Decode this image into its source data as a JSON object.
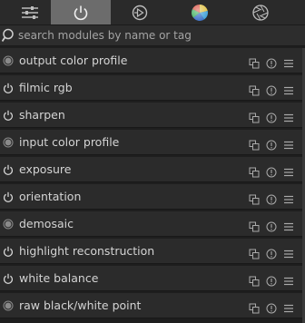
{
  "tabs": [
    {
      "icon": "sliders-icon",
      "active": false
    },
    {
      "icon": "power-icon",
      "active": true
    },
    {
      "icon": "play-circle-icon",
      "active": false
    },
    {
      "icon": "color-wheel-icon",
      "active": false
    },
    {
      "icon": "aperture-icon",
      "active": false
    }
  ],
  "search": {
    "placeholder": "search modules by name or tag",
    "value": ""
  },
  "modules": [
    {
      "label": "output color profile",
      "state": "always-on"
    },
    {
      "label": "filmic rgb",
      "state": "on"
    },
    {
      "label": "sharpen",
      "state": "on"
    },
    {
      "label": "input color profile",
      "state": "always-on"
    },
    {
      "label": "exposure",
      "state": "on"
    },
    {
      "label": "orientation",
      "state": "on"
    },
    {
      "label": "demosaic",
      "state": "always-on"
    },
    {
      "label": "highlight reconstruction",
      "state": "on"
    },
    {
      "label": "white balance",
      "state": "on"
    },
    {
      "label": "raw black/white point",
      "state": "always-on"
    }
  ],
  "colors": {
    "active_tab": "#6c6c6c",
    "row_bg": "#2b2b2b",
    "text": "#d4d4d4"
  }
}
